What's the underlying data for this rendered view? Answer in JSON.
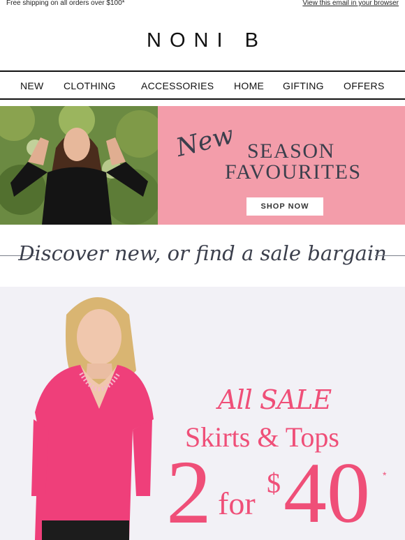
{
  "topbar": {
    "shipping": "Free shipping on all orders over $100*",
    "view_browser": "View this email in your browser"
  },
  "brand": {
    "logo": "NONI B"
  },
  "nav": [
    "NEW",
    "CLOTHING",
    "ACCESSORIES",
    "HOME",
    "GIFTING",
    "OFFERS"
  ],
  "hero": {
    "script_word": "New",
    "line1": "SEASON",
    "line2": "FAVOURITES",
    "cta": "SHOP NOW",
    "panel_color": "#f39daa"
  },
  "discover": {
    "text": "Discover new, or find a sale bargain"
  },
  "sale": {
    "line1": "All SALE",
    "line2": "Skirts & Tops",
    "qty": "2",
    "for": "for",
    "currency": "$",
    "price": "40",
    "asterisk": "*",
    "accent": "#ef4f78"
  }
}
